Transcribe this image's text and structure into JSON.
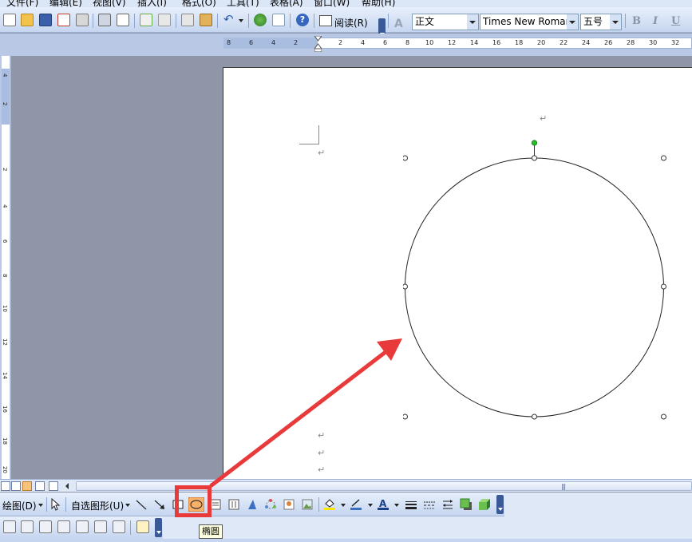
{
  "menu": [
    "文件(F)",
    "编辑(E)",
    "视图(V)",
    "插入(I)",
    "格式(O)",
    "工具(T)",
    "表格(A)",
    "窗口(W)",
    "帮助(H)"
  ],
  "toolbar": {
    "read_label": "阅读(R)",
    "style_value": "正文",
    "font_value": "Times New Roman",
    "size_value": "五号",
    "bold": "B",
    "italic": "I",
    "underline": "U"
  },
  "ruler_h": [
    "8",
    "6",
    "4",
    "2",
    "2",
    "4",
    "6",
    "8",
    "10",
    "12",
    "14",
    "16",
    "18",
    "20",
    "22",
    "24",
    "26",
    "28",
    "30",
    "32"
  ],
  "ruler_v": [
    "4",
    "2",
    "2",
    "4",
    "6",
    "8",
    "10",
    "12",
    "14",
    "16",
    "18",
    "20"
  ],
  "page": {
    "para_mark": "↵"
  },
  "drawing_toolbar": {
    "draw_label": "绘图(D)",
    "autoshape_label": "自选图形(U)"
  },
  "tooltip": "椭圆",
  "colors": {
    "highlight": "#e83a3a",
    "arrow": "#e83a3a",
    "ellipse_button": "#f7b06a",
    "rotate_handle": "#22c222"
  }
}
